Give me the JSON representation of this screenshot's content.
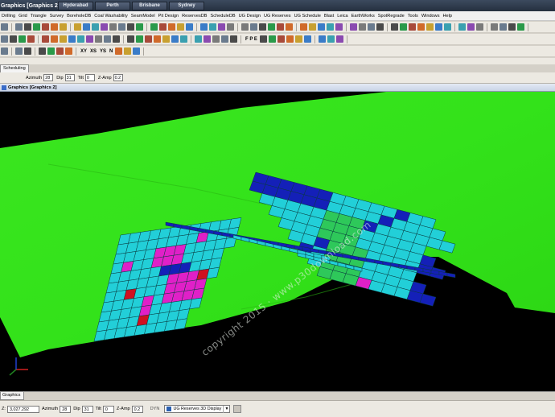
{
  "window": {
    "title": "Graphics [Graphics 2]",
    "city_tabs": [
      "Hyderabad",
      "Perth",
      "Brisbane",
      "Sydney"
    ]
  },
  "menu": {
    "items": [
      "Drilling",
      "Grid",
      "Triangle",
      "Survey",
      "BoreholeDB",
      "Coal Washability",
      "SeamModel",
      "Pit Design",
      "ReservesDB",
      "ScheduleDB",
      "UG Design",
      "UG Reserves",
      "UG Schedule",
      "Blast",
      "Leica",
      "EarthWorks",
      "SpotRegrade",
      "Tools",
      "Windows",
      "Help"
    ]
  },
  "toolbar_text": {
    "fpe": "F P E",
    "axis_xy": "XY",
    "axis_xs": "XS",
    "axis_ys": "YS",
    "axis_n": "N"
  },
  "tabs": {
    "scheduling": "Scheduling"
  },
  "params": {
    "azimuth_label": "Azimuth",
    "azimuth_value": "28",
    "dip_label": "Dip",
    "dip_value": "31",
    "tilt_label": "Tilt",
    "tilt_value": "0",
    "zamp_label": "Z-Amp",
    "zamp_value": "0.2"
  },
  "graphics": {
    "title": "Graphics [Graphics 2]",
    "watermark": "copyright 2015 · www.p30download.com"
  },
  "bottom_tabs": {
    "active": "Graphics 2"
  },
  "status": {
    "z_label": "Z:",
    "z_value": "3,027.292",
    "azimuth_label": "Azimuth",
    "azimuth_value": "28",
    "dip_label": "Dip",
    "dip_value": "31",
    "tilt_label": "Tilt",
    "tilt_value": "0",
    "zamp_label": "Z-Amp",
    "zamp_value": "0.2",
    "dyn_label": "DYN",
    "display_value": "UG Reserves 3D Display"
  },
  "colors": {
    "ground": "#33e21a",
    "block_cyan": "#22cfd8",
    "block_blue": "#1420b8",
    "block_magenta": "#e020c8",
    "block_red": "#d01020",
    "block_green": "#2ec85a"
  },
  "icons": {
    "toolbar": [
      "file-icon",
      "edit-icon",
      "view-icon",
      "zoom-icon",
      "rotate-icon",
      "layer-icon",
      "select-icon",
      "measure-icon"
    ],
    "axis_gizmo": "axis-triad-icon"
  }
}
